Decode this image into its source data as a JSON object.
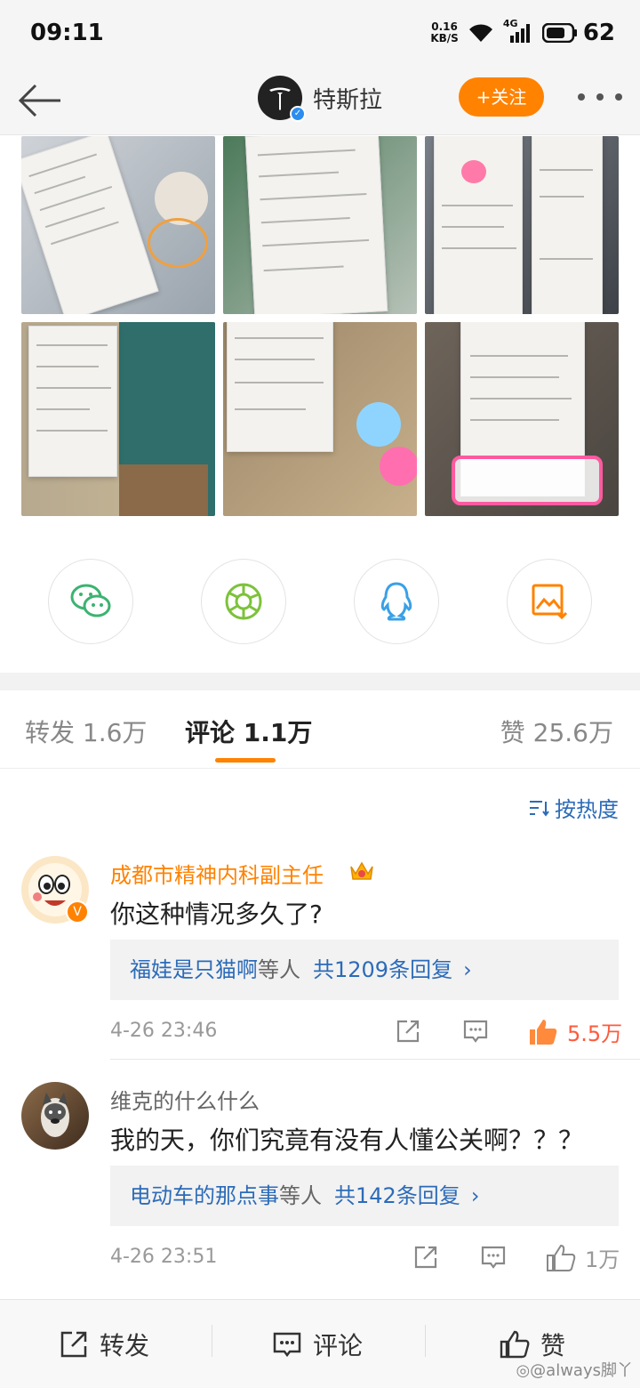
{
  "status_bar": {
    "time": "09:11",
    "net_speed_value": "0.16",
    "net_speed_unit": "KB/S",
    "network": "4G",
    "battery": "62"
  },
  "header": {
    "account_name": "特斯拉",
    "follow_label": "+关注"
  },
  "images": [
    {
      "desc": "receipt-1"
    },
    {
      "desc": "receipt-2"
    },
    {
      "desc": "receipt-3"
    },
    {
      "desc": "receipt-4"
    },
    {
      "desc": "receipt-5"
    },
    {
      "desc": "receipt-6"
    }
  ],
  "share_targets": [
    {
      "icon": "wechat-icon",
      "color": "#3cb371"
    },
    {
      "icon": "moments-icon",
      "color": "#7dc23a"
    },
    {
      "icon": "qq-icon",
      "color": "#3aa0e6"
    },
    {
      "icon": "save-image-icon",
      "color": "#ff8200"
    }
  ],
  "tabs": {
    "repost": "转发 1.6万",
    "comments": "评论 1.1万",
    "likes": "赞 25.6万"
  },
  "sort_label": "按热度",
  "comments": [
    {
      "username": "成都市精神内科副主任",
      "name_color": "#ff8200",
      "text": "你这种情况多久了?",
      "reply_user": "福娃是只猫啊",
      "reply_mid": "等人",
      "reply_count": "共1209条回复",
      "time": "4-26 23:46",
      "likes": "5.5万",
      "liked": true
    },
    {
      "username": "维克的什么什么",
      "name_color": "#666666",
      "text": "我的天，你们究竟有没有人懂公关啊？？？",
      "reply_user": "电动车的那点事",
      "reply_mid": "等人",
      "reply_count": "共142条回复",
      "time": "4-26 23:51",
      "likes": "1万",
      "liked": false
    }
  ],
  "bottom_bar": {
    "repost": "转发",
    "comment": "评论",
    "like": "赞"
  },
  "watermark": "@always脚丫"
}
